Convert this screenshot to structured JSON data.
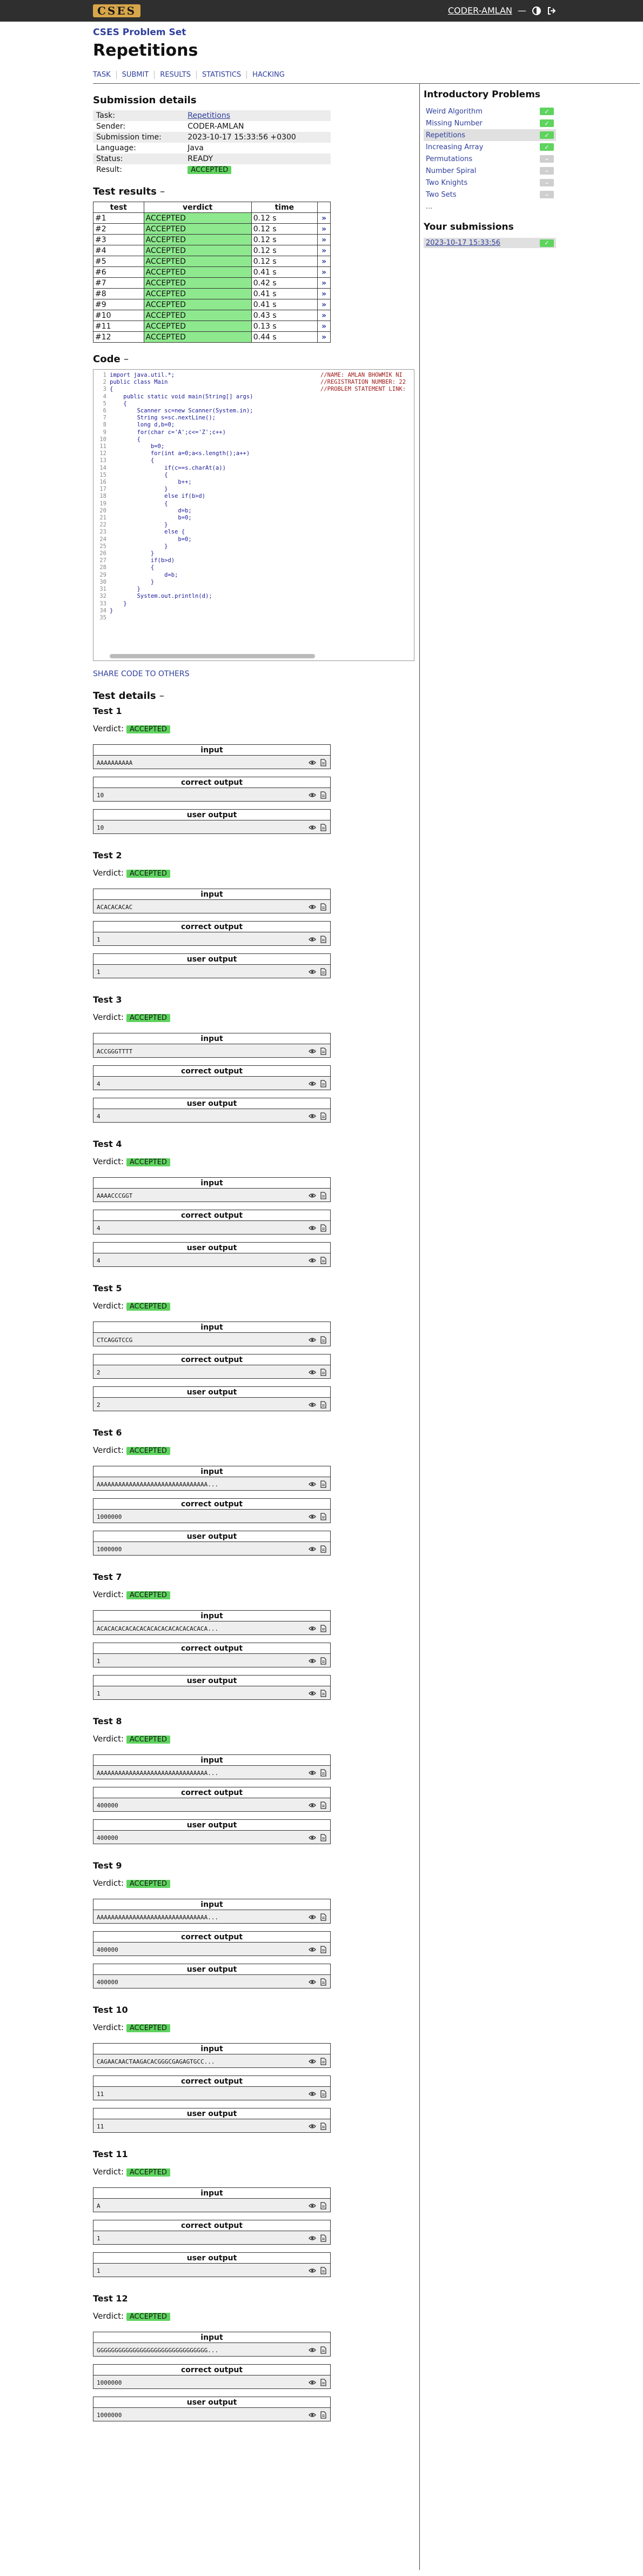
{
  "topbar": {
    "logo": "CSES",
    "user": "CODER-AMLAN",
    "separator": "—"
  },
  "header": {
    "subtitle": "CSES Problem Set",
    "title": "Repetitions"
  },
  "nav": [
    "TASK",
    "SUBMIT",
    "RESULTS",
    "STATISTICS",
    "HACKING"
  ],
  "submission": {
    "heading": "Submission details",
    "rows": [
      {
        "label": "Task:",
        "value": "Repetitions"
      },
      {
        "label": "Sender:",
        "value": "CODER-AMLAN"
      },
      {
        "label": "Submission time:",
        "value": "2023-10-17 15:33:56 +0300"
      },
      {
        "label": "Language:",
        "value": "Java"
      },
      {
        "label": "Status:",
        "value": "READY"
      },
      {
        "label": "Result:",
        "value": "ACCEPTED"
      }
    ]
  },
  "results": {
    "heading": "Test results",
    "columns": [
      "test",
      "verdict",
      "time"
    ],
    "rows": [
      [
        "#1",
        "ACCEPTED",
        "0.12 s"
      ],
      [
        "#2",
        "ACCEPTED",
        "0.12 s"
      ],
      [
        "#3",
        "ACCEPTED",
        "0.12 s"
      ],
      [
        "#4",
        "ACCEPTED",
        "0.12 s"
      ],
      [
        "#5",
        "ACCEPTED",
        "0.12 s"
      ],
      [
        "#6",
        "ACCEPTED",
        "0.41 s"
      ],
      [
        "#7",
        "ACCEPTED",
        "0.42 s"
      ],
      [
        "#8",
        "ACCEPTED",
        "0.41 s"
      ],
      [
        "#9",
        "ACCEPTED",
        "0.41 s"
      ],
      [
        "#10",
        "ACCEPTED",
        "0.43 s"
      ],
      [
        "#11",
        "ACCEPTED",
        "0.13 s"
      ],
      [
        "#12",
        "ACCEPTED",
        "0.44 s"
      ]
    ],
    "link_glyph": "»"
  },
  "code": {
    "heading": "Code",
    "lines": [
      "import java.util.*;",
      "public class Main",
      "{",
      "    public static void main(String[] args)",
      "    {",
      "        Scanner sc=new Scanner(System.in);",
      "        String s=sc.nextLine();",
      "        long d,b=0;",
      "        for(char c='A';c<='Z';c++)",
      "        {",
      "            b=0;",
      "            for(int a=0;a<s.length();a++)",
      "            {",
      "                if(c==s.charAt(a))",
      "                {",
      "                    b++;",
      "                }",
      "                else if(b>d)",
      "                {",
      "                    d=b;",
      "                    b=0;",
      "                }",
      "                else {",
      "                    b=0;",
      "                }",
      "            }",
      "            if(b>d)",
      "            {",
      "                d=b;",
      "            }",
      "        }",
      "        System.out.println(d);",
      "    }",
      "}",
      ""
    ],
    "comments": [
      "//NAME: AMLAN BHOWMIK NI",
      "//REGISTRATION NUMBER: 22",
      "//PROBLEM STATEMENT LINK:"
    ],
    "share": "SHARE CODE TO OTHERS"
  },
  "test_details": {
    "heading": "Test details",
    "verdict_label": "Verdict:",
    "input_label": "input",
    "correct_label": "correct output",
    "user_label": "user output",
    "tests": [
      {
        "title": "Test 1",
        "verdict": "ACCEPTED",
        "input": "AAAAAAAAAA",
        "correct": "10",
        "user": "10"
      },
      {
        "title": "Test 2",
        "verdict": "ACCEPTED",
        "input": "ACACACACAC",
        "correct": "1",
        "user": "1"
      },
      {
        "title": "Test 3",
        "verdict": "ACCEPTED",
        "input": "ACCGGGTTTT",
        "correct": "4",
        "user": "4"
      },
      {
        "title": "Test 4",
        "verdict": "ACCEPTED",
        "input": "AAAACCCGGT",
        "correct": "4",
        "user": "4"
      },
      {
        "title": "Test 5",
        "verdict": "ACCEPTED",
        "input": "CTCAGGTCCG",
        "correct": "2",
        "user": "2"
      },
      {
        "title": "Test 6",
        "verdict": "ACCEPTED",
        "input": "AAAAAAAAAAAAAAAAAAAAAAAAAAAAAAA...",
        "correct": "1000000",
        "user": "1000000"
      },
      {
        "title": "Test 7",
        "verdict": "ACCEPTED",
        "input": "ACACACACACACACACACACACACACACACA...",
        "correct": "1",
        "user": "1"
      },
      {
        "title": "Test 8",
        "verdict": "ACCEPTED",
        "input": "AAAAAAAAAAAAAAAAAAAAAAAAAAAAAAA...",
        "correct": "400000",
        "user": "400000"
      },
      {
        "title": "Test 9",
        "verdict": "ACCEPTED",
        "input": "AAAAAAAAAAAAAAAAAAAAAAAAAAAAAAA...",
        "correct": "400000",
        "user": "400000"
      },
      {
        "title": "Test 10",
        "verdict": "ACCEPTED",
        "input": "CAGAACAACTAAGACACGGGCGAGAGTGCC...",
        "correct": "11",
        "user": "11"
      },
      {
        "title": "Test 11",
        "verdict": "ACCEPTED",
        "input": "A",
        "correct": "1",
        "user": "1"
      },
      {
        "title": "Test 12",
        "verdict": "ACCEPTED",
        "input": "GGGGGGGGGGGGGGGGGGGGGGGGGGGGGGG...",
        "correct": "1000000",
        "user": "1000000"
      }
    ]
  },
  "sidebar": {
    "heading": "Introductory Problems",
    "tasks": [
      {
        "name": "Weird Algorithm",
        "status": "✓",
        "solved": true
      },
      {
        "name": "Missing Number",
        "status": "✓",
        "solved": true
      },
      {
        "name": "Repetitions",
        "status": "✓",
        "solved": true,
        "current": true
      },
      {
        "name": "Increasing Array",
        "status": "✓",
        "solved": true
      },
      {
        "name": "Permutations",
        "status": "–",
        "solved": false
      },
      {
        "name": "Number Spiral",
        "status": "–",
        "solved": false
      },
      {
        "name": "Two Knights",
        "status": "–",
        "solved": false
      },
      {
        "name": "Two Sets",
        "status": "–",
        "solved": false
      }
    ],
    "more": "...",
    "subs_heading": "Your submissions",
    "submissions": [
      {
        "time": "2023-10-17 15:33:56",
        "status": "✓"
      }
    ]
  },
  "colors": {
    "accent": "#2f3f9c",
    "accepted": "#5fd35f",
    "verdict_cell": "#8ee88e",
    "topbar": "#2f2f2f"
  }
}
